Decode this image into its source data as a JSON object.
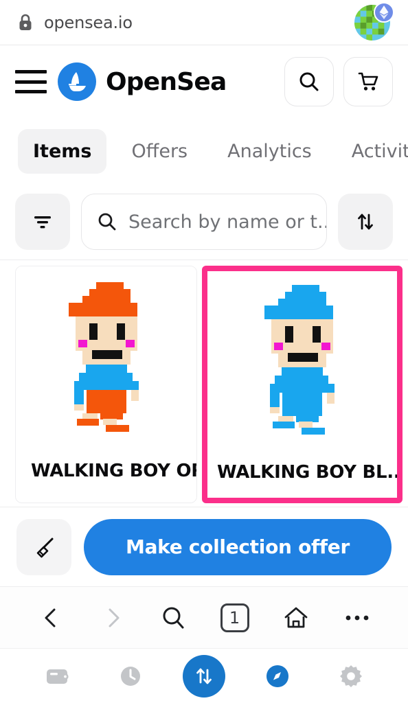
{
  "browser": {
    "url": "opensea.io",
    "lock_icon": "lock-icon",
    "avatar_icon": "identicon-avatar",
    "network_badge_icon": "ethereum-badge-icon"
  },
  "site_header": {
    "menu_icon": "hamburger-menu-icon",
    "logo_icon": "opensea-sailboat-logo-icon",
    "wordmark": "OpenSea",
    "search_icon": "search-icon",
    "cart_icon": "shopping-cart-icon"
  },
  "tabs": [
    {
      "label": "Items",
      "active": true
    },
    {
      "label": "Offers",
      "active": false
    },
    {
      "label": "Analytics",
      "active": false
    },
    {
      "label": "Activity",
      "active": false
    }
  ],
  "filter_row": {
    "filter_icon": "filter-funnel-icon",
    "search": {
      "placeholder": "Search by name or t...",
      "value": "",
      "icon": "search-icon"
    },
    "sort_icon": "sort-updown-arrows-icon"
  },
  "items": [
    {
      "title": "WALKING BOY OR...",
      "selected": false,
      "sprite_palette": {
        "hat": "#F4560B",
        "skin": "#F7DDBD",
        "eye": "#111111",
        "cheek": "#F217D0",
        "shirt": "#19A6EE",
        "pants": "#F4560B",
        "shoes": "#F4560B"
      }
    },
    {
      "title": "WALKING BOY BL...",
      "selected": true,
      "selection_color": "#FB2F8A",
      "sprite_palette": {
        "hat": "#19A6EE",
        "skin": "#F7DDBD",
        "eye": "#111111",
        "cheek": "#F217D0",
        "shirt": "#19A6EE",
        "pants": "#19A6EE",
        "shoes": "#19A6EE"
      }
    }
  ],
  "offer_bar": {
    "sweep_icon": "broom-sweep-icon",
    "primary_label": "Make collection offer",
    "primary_color": "#2081E2"
  },
  "browser_nav": {
    "back_icon": "chevron-left-back-icon",
    "forward_icon": "chevron-right-forward-icon",
    "search_icon": "search-icon",
    "tab_count": "1",
    "tabs_icon": "tab-count-icon",
    "home_icon": "home-icon",
    "more_icon": "more-ellipsis-icon"
  },
  "system_bar": {
    "wallet_icon": "wallet-icon",
    "history_icon": "clock-history-icon",
    "swap_icon": "swap-arrows-icon",
    "browser_icon": "compass-browser-icon",
    "settings_icon": "gear-settings-icon",
    "active_item": "browser-icon",
    "accent_color": "#1877C9"
  }
}
